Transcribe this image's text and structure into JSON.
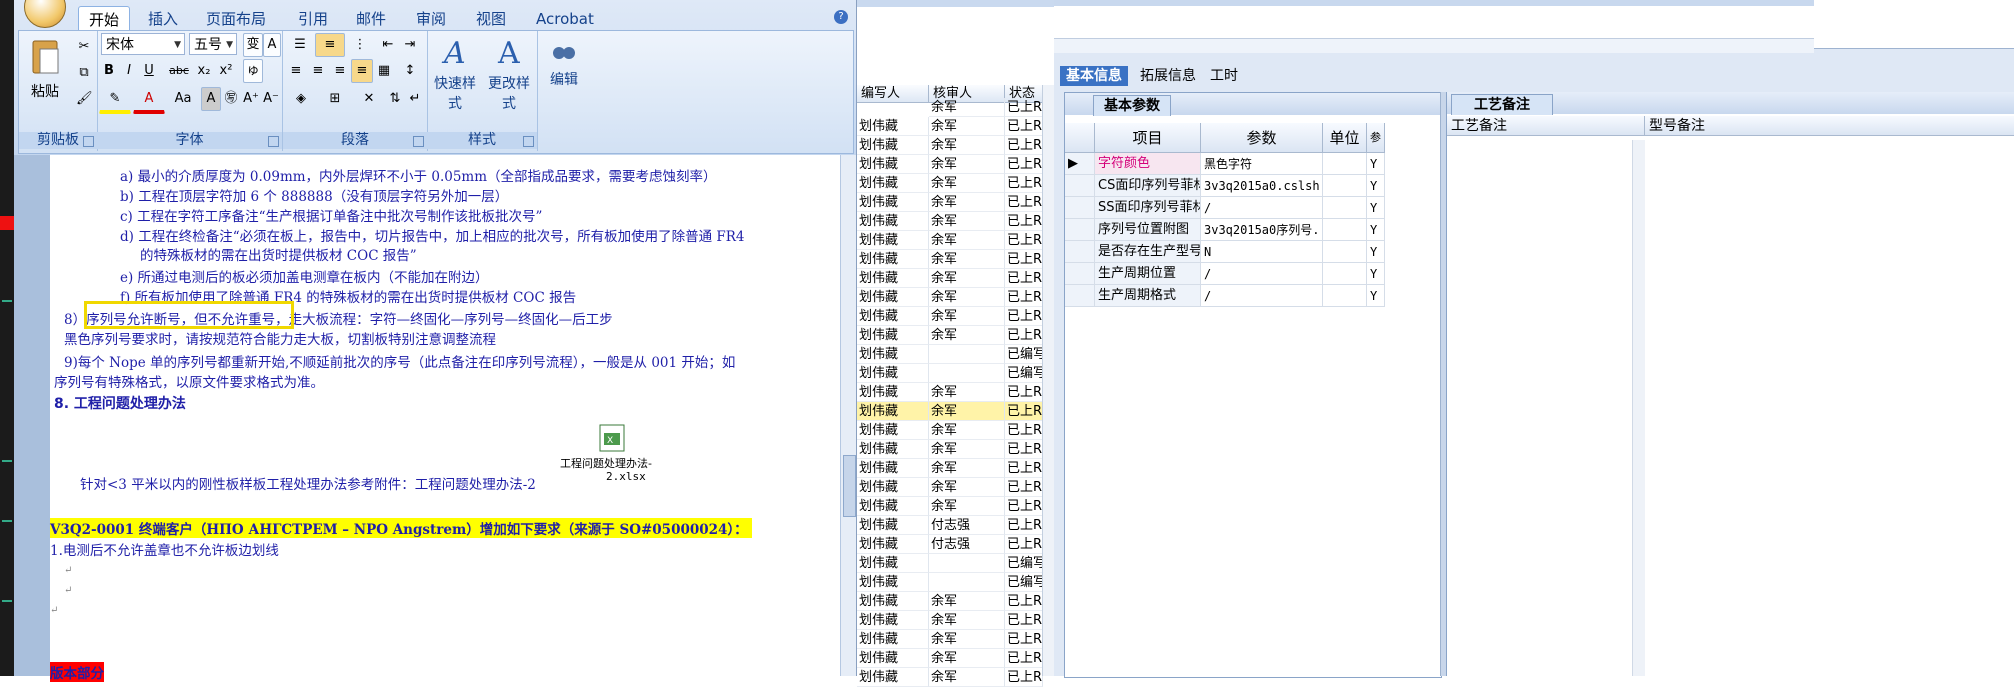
{
  "colors": {
    "ribbon_text": "#15428b",
    "doc_text": "#1f1fa8",
    "highlight_yellow": "#ffff00",
    "highlight_box": "#f0d800",
    "selected_row": "#fff3a8",
    "red_label": "#ff0000"
  },
  "word": {
    "tabs": [
      "开始",
      "插入",
      "页面布局",
      "引用",
      "邮件",
      "审阅",
      "视图",
      "Acrobat"
    ],
    "active_tab": "开始",
    "font_name": "宋体",
    "font_size": "五号",
    "groups": {
      "clipboard": "剪贴板",
      "font": "字体",
      "paragraph": "段落",
      "styles": "样式"
    },
    "paste_label": "粘贴",
    "quick_styles": "快速样式",
    "change_styles": "更改样式",
    "edit_label": "编辑",
    "format_buttons": {
      "bold": "B",
      "italic": "I",
      "underline": "U",
      "strike": "abc",
      "sub": "x₂",
      "sup": "x²",
      "aa": "Aa",
      "a_box": "A",
      "grow": "A⁺",
      "shrink": "A⁻"
    },
    "doc_lines": [
      "a)  最小的介质厚度为 0.09mm，内外层焊环不小于 0.05mm（全部指成品要求，需要考虑蚀刻率）",
      "b)  工程在顶层字符加 6 个 888888（没有顶层字符另外加一层）",
      "c)  工程在字符工序备注“生产根据订单备注中批次号制作该批板批次号”",
      "d)  工程在终检备注“必须在板上，报告中，切片报告中，加上相应的批次号，所有板加使用了除普通 FR4",
      "的特殊板材的需在出货时提供板材 COC 报告”",
      "e)  所通过电测后的板必须加盖电测章在板内（不能加在附边）",
      "f)  所有板加使用了除普通 FR4 的特殊板材的需在出货时提供板材 COC 报告",
      "8）序列号允许断号，但不允许重号，走大板流程：字符—终固化—序列号—终固化—后工步",
      "黑色序列号要求时，请按规范符合能力走大板，切割板特别注意调整流程",
      "9)每个 Nope 单的序列号都重新开始,不顺延前批次的序号（此点备注在印序列号流程），一般是从 001 开始；如",
      "序列号有特殊格式，以原文件要求格式为准。",
      "8. 工程问题处理办法",
      "针对<3 平米以内的刚性板样板工程处理办法参考附件：工程问题处理办法-2",
      "V3Q2-0001 终端客户（НПО АНГСТРЕМ – NPO Angstrem）增加如下要求（来源于 SO#05000024）：",
      "1.电测后不允许盖章也不允许板边划线",
      "版本部分"
    ],
    "highlight_text": "序列号允许断号，但不允许重号，",
    "attachment_name": "工程问题处理办法-",
    "attachment_file": "2.xlsx"
  },
  "mid_grid": {
    "columns": [
      "编写人",
      "核审人",
      "状态"
    ],
    "rows": [
      [
        "划伟藏",
        "余军",
        "已上R"
      ],
      [
        "划伟藏",
        "余军",
        "已上R"
      ],
      [
        "划伟藏",
        "余军",
        "已上R"
      ],
      [
        "划伟藏",
        "余军",
        "已上R"
      ],
      [
        "划伟藏",
        "余军",
        "已上R"
      ],
      [
        "划伟藏",
        "余军",
        "已上R"
      ],
      [
        "划伟藏",
        "余军",
        "已上R"
      ],
      [
        "划伟藏",
        "余军",
        "已上R"
      ],
      [
        "划伟藏",
        "余军",
        "已上R"
      ],
      [
        "划伟藏",
        "余军",
        "已上R"
      ],
      [
        "划伟藏",
        "余军",
        "已上R"
      ],
      [
        "划伟藏",
        "余军",
        "已上R"
      ],
      [
        "划伟藏",
        "",
        "已编写"
      ],
      [
        "划伟藏",
        "",
        "已编写"
      ],
      [
        "划伟藏",
        "余军",
        "已上R"
      ],
      [
        "划伟藏",
        "余军",
        "已上R"
      ],
      [
        "划伟藏",
        "余军",
        "已上R"
      ],
      [
        "划伟藏",
        "余军",
        "已上R"
      ],
      [
        "划伟藏",
        "余军",
        "已上R"
      ],
      [
        "划伟藏",
        "余军",
        "已上R"
      ],
      [
        "划伟藏",
        "余军",
        "已上R"
      ],
      [
        "划伟藏",
        "付志强",
        "已上R"
      ],
      [
        "划伟藏",
        "付志强",
        "已上R"
      ],
      [
        "划伟藏",
        "",
        "已编写"
      ],
      [
        "划伟藏",
        "",
        "已编写"
      ],
      [
        "划伟藏",
        "余军",
        "已上R"
      ],
      [
        "划伟藏",
        "余军",
        "已上R"
      ],
      [
        "划伟藏",
        "余军",
        "已上R"
      ],
      [
        "划伟藏",
        "余军",
        "已上R"
      ],
      [
        "划伟藏",
        "余军",
        "已上R"
      ]
    ],
    "top_row": [
      "余军",
      "已上R"
    ],
    "selected_index": 15
  },
  "right": {
    "tabs": [
      "基本信息",
      "拓展信息",
      "工时"
    ],
    "basic_tab": "基本参数",
    "craft_tab": "工艺备注",
    "columns": [
      "项目",
      "参数",
      "单位",
      "参"
    ],
    "rows": [
      {
        "item": "字符颜色",
        "value": "黑色字符",
        "unit": "",
        "flag": "Y"
      },
      {
        "item": "CS面印序列号菲林",
        "value": "3v3q2015a0.cslsh",
        "unit": "",
        "flag": "Y"
      },
      {
        "item": "SS面印序列号菲林",
        "value": "/",
        "unit": "",
        "flag": "Y"
      },
      {
        "item": "序列号位置附图",
        "value": "3v3q2015a0序列号...",
        "unit": "",
        "flag": "Y"
      },
      {
        "item": "是否存在生产型号",
        "value": "N",
        "unit": "",
        "flag": "Y"
      },
      {
        "item": "生产周期位置",
        "value": "/",
        "unit": "",
        "flag": "Y"
      },
      {
        "item": "生产周期格式",
        "value": "/",
        "unit": "",
        "flag": "Y"
      }
    ],
    "craft_columns": [
      "工艺备注",
      "型号备注"
    ]
  }
}
